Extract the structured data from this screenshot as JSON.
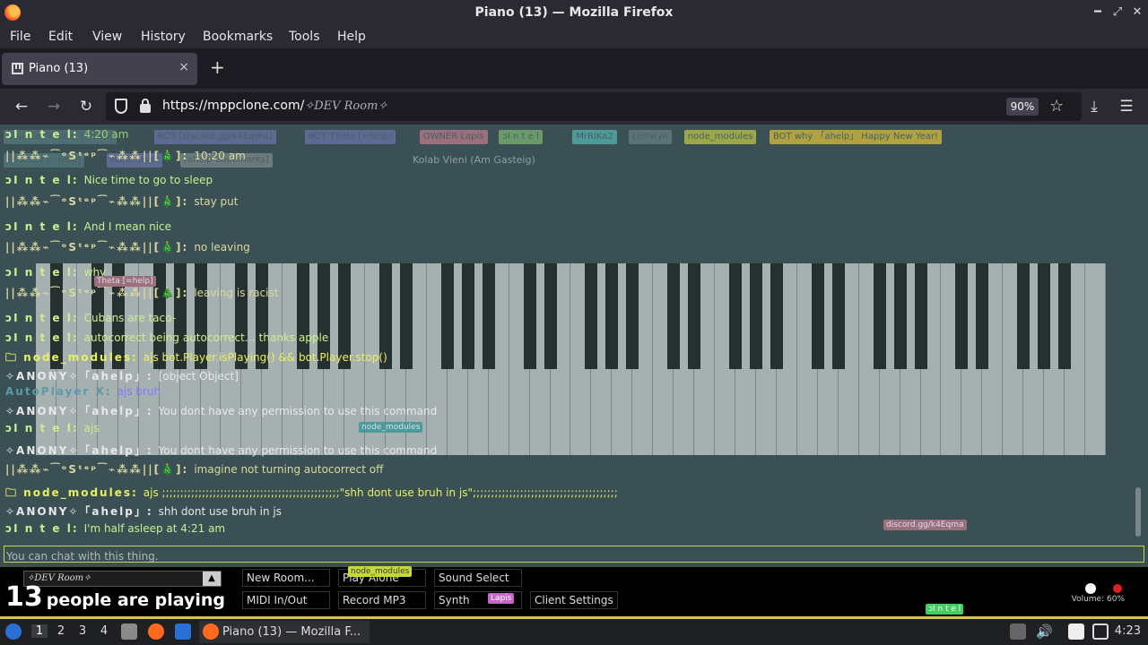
{
  "window": {
    "title": "Piano (13) — Mozilla Firefox"
  },
  "menu": [
    "File",
    "Edit",
    "View",
    "History",
    "Bookmarks",
    "Tools",
    "Help"
  ],
  "tab": {
    "title": "Piano (13)",
    "close": "×",
    "new": "+"
  },
  "nav": {
    "url_main": "https://mppclone.com/",
    "url_room": "✧DEV Room✧",
    "zoom": "90%"
  },
  "userbar": [
    {
      "label": "Bouncer Walker | [help]",
      "color": "#4d6e73"
    },
    {
      "label": "BOT [discord.gg/k4Eqma]",
      "color": "#5d6a94"
    },
    {
      "label": "BOT Theta [=help]",
      "color": "#5d6a94"
    },
    {
      "label": "OWNER Lapis",
      "color": "#9b6f7c"
    },
    {
      "label": "ɔI n t e l",
      "color": "#6a9a6a"
    },
    {
      "label": "MrRiKa2",
      "color": "#4c9a9a"
    },
    {
      "label": "certwyn",
      "color": "#5b7377"
    },
    {
      "label": "node_modules",
      "color": "#9aa84a"
    },
    {
      "label": "BOT why 「ahelp」 Happy New Year!",
      "color": "#b0a240"
    }
  ],
  "userbar2": [
    {
      "label": "Bouncer [=help]",
      "color": "#4d6e73"
    },
    {
      "label": "AutoPlayer",
      "color": "#5d6a94"
    },
    {
      "label": "[ahelp Bookmarks]",
      "color": "#6b7a7c"
    }
  ],
  "other_cursor": "Kolab Vieni (Am Gasteig)",
  "messages": [
    {
      "name": "ɔI n t e l:",
      "text": "4:20 am",
      "color": "#9ad06a",
      "ncolor": "#c8f090"
    },
    {
      "name": "||⁂⁂⌁⁀ᵒSᵗᵉᵖ⁀⌁⁂⁂||[🎄]:",
      "text": "10:20 am",
      "color": "#d8d8a0",
      "ncolor": "#d8d8a0"
    },
    {
      "name": "ɔI n t e l:",
      "text": "Nice time to go to sleep",
      "color": "#c8f090",
      "ncolor": "#c8f090"
    },
    {
      "name": "||⁂⁂⌁⁀ᵒSᵗᵉᵖ⁀⌁⁂⁂||[🎄]:",
      "text": "stay put",
      "color": "#d8d8a0",
      "ncolor": "#d8d8a0"
    },
    {
      "name": "ɔI n t e l:",
      "text": "And I mean nice",
      "color": "#c8f090",
      "ncolor": "#c8f090"
    },
    {
      "name": "||⁂⁂⌁⁀ᵒSᵗᵉᵖ⁀⌁⁂⁂||[🎄]:",
      "text": "no leaving",
      "color": "#d8d8a0",
      "ncolor": "#d8d8a0"
    },
    {
      "name": "ɔI n t e l:",
      "text": "why",
      "color": "#c8f090",
      "ncolor": "#c8f090"
    },
    {
      "name": "||⁂⁂⌁⁀ᵒSᵗᵉᵖ⁀⌁⁂⁂||[🎄]:",
      "text": "leaving is racist",
      "color": "#d8d8a0",
      "ncolor": "#d8d8a0"
    },
    {
      "name": "ɔI n t e l:",
      "text": "Cubans are taco-",
      "color": "#c8f090",
      "ncolor": "#c8f090"
    },
    {
      "name": "ɔI n t e l:",
      "text": "autocorrect being autocorrect… thanks apple",
      "color": "#c8f090",
      "ncolor": "#c8f090"
    },
    {
      "name": "🗀 node_modules:",
      "text": "ajs bot.Player.isPlaying() && bot.Player.stop()",
      "color": "#e8f060",
      "ncolor": "#e8f060"
    },
    {
      "name": "✧ANONY✧「ahelp」:",
      "text": "[object Object]",
      "color": "#e8e8e8",
      "ncolor": "#e8e8e8"
    },
    {
      "name": "AutoPlayer X:",
      "text": "ajs bruh",
      "color": "#7a7aff",
      "ncolor": "#5a9aaa"
    },
    {
      "name": "✧ANONY✧「ahelp」:",
      "text": "You dont have any permission to use this command",
      "color": "#e8e8e8",
      "ncolor": "#e8e8e8"
    },
    {
      "name": "ɔI n t e l:",
      "text": "ajs",
      "color": "#c8f090",
      "ncolor": "#c8f090"
    },
    {
      "name": "✧ANONY✧「ahelp」:",
      "text": "You dont have any permission to use this command",
      "color": "#e8e8e8",
      "ncolor": "#e8e8e8"
    },
    {
      "name": "||⁂⁂⌁⁀ᵒSᵗᵉᵖ⁀⌁⁂⁂||[🎄]:",
      "text": "imagine not turning autocorrect off",
      "color": "#d8d8a0",
      "ncolor": "#d8d8a0"
    },
    {
      "name": "🗀 node_modules:",
      "text": "ajs ;;;;;;;;;;;;;;;;;;;;;;;;;;;;;;;;;;;;;;;;;;;;;;;;;\"shh dont use bruh in js\";;;;;;;;;;;;;;;;;;;;;;;;;;;;;;;;;;;;;;;;",
      "color": "#e8f060",
      "ncolor": "#e8f060"
    },
    {
      "name": "✧ANONY✧「ahelp」:",
      "text": "shh dont use bruh in js",
      "color": "#e8e8e8",
      "ncolor": "#e8e8e8"
    },
    {
      "name": "ɔI n t e l:",
      "text": "I'm half asleep at 4:21 am",
      "color": "#c8f090",
      "ncolor": "#c8f090"
    }
  ],
  "chat_placeholder": "You can chat with this thing.",
  "floating_labels": [
    {
      "label": "discord.gg/k4Eqma",
      "color": "#9b6f7c"
    },
    {
      "label": "Theta [=help]",
      "color": "#9b6f7c"
    },
    {
      "label": "node_modules",
      "color": "#4c9a9a"
    }
  ],
  "bottom": {
    "room": "✧DEV Room✧",
    "room_arrow": "▲",
    "count": "13",
    "playing_text": "people are playing",
    "buttons": [
      "New Room...",
      "Play Alone",
      "Sound Select",
      "MIDI In/Out",
      "Record MP3",
      "Synth",
      "Client Settings"
    ],
    "node_tag": "node_modules",
    "lapis_tag": "Lapis",
    "intel_tag": "ɔI n t e l",
    "volume": "Volume: 60%"
  },
  "taskbar": {
    "workspaces": [
      "1",
      "2",
      "3",
      "4"
    ],
    "task_title": "Piano (13) — Mozilla F...",
    "clock": "4:23"
  }
}
